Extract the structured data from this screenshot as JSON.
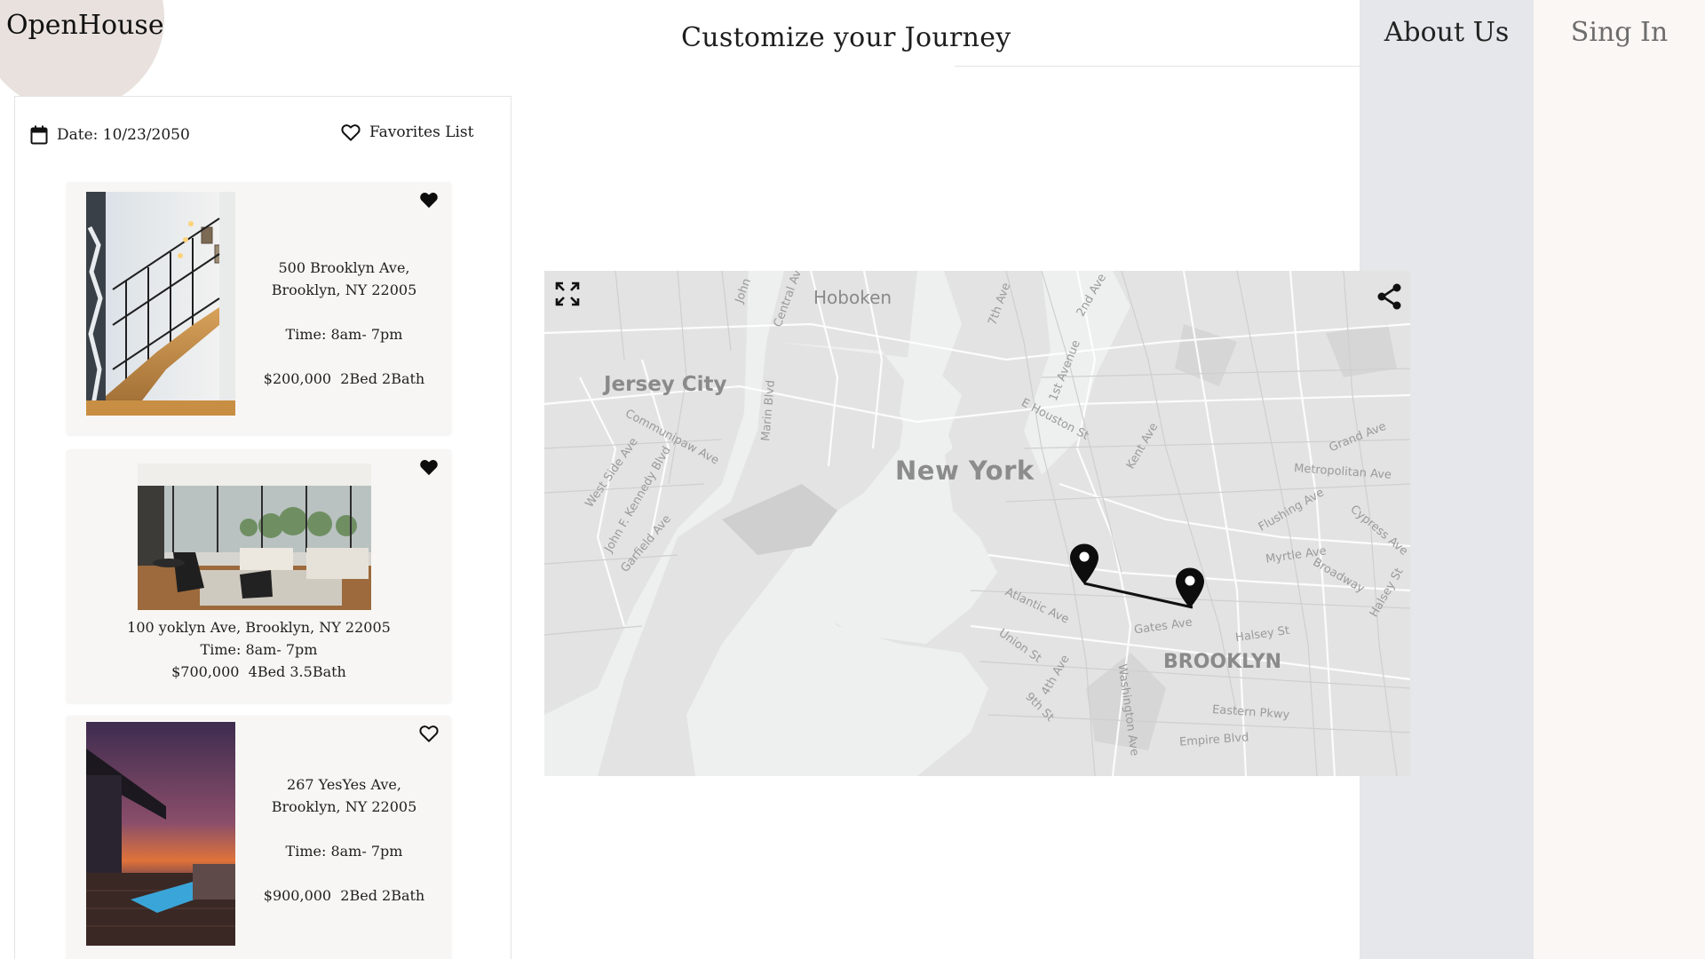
{
  "brand": {
    "name": "OpenHouse"
  },
  "header": {
    "title": "Customize your Journey"
  },
  "nav": {
    "about": "About Us",
    "signin": "Sing In"
  },
  "sidebar": {
    "date_label": "Date: 10/23/2050",
    "favorites_label": "Favorites List",
    "listings": [
      {
        "address_line1": "500 Brooklyn Ave,",
        "address_line2": "Brooklyn, NY 22005",
        "time": "Time: 8am- 7pm",
        "price": "$200,000",
        "details": "2Bed 2Bath",
        "favorited": true
      },
      {
        "address": "100 yoklyn Ave, Brooklyn, NY 22005",
        "time": "Time: 8am- 7pm",
        "price": "$700,000",
        "details": "4Bed 3.5Bath",
        "favorited": true
      },
      {
        "address_line1": "267 YesYes Ave,",
        "address_line2": "Brooklyn, NY 22005",
        "time": "Time: 8am- 7pm",
        "price": "$900,000",
        "details": "2Bed 2Bath",
        "favorited": false
      }
    ]
  },
  "map": {
    "labels": {
      "hoboken": "Hoboken",
      "jersey_city": "Jersey City",
      "new_york": "New York",
      "brooklyn": "BROOKLYN",
      "grand_ave": "Grand Ave",
      "metropolitan_ave": "Metropolitan Ave",
      "flushing_ave": "Flushing Ave",
      "myrtle_ave": "Myrtle Ave",
      "broadway": "Broadway",
      "cypress_ave": "Cypress Ave",
      "halsey_st_e": "Halsey St",
      "atlantic_ave": "Atlantic Ave",
      "gates_ave": "Gates Ave",
      "halsey_st": "Halsey St",
      "union_st": "Union St",
      "fourth_ave": "4th Ave",
      "ninth_st": "9th St",
      "washington_ave": "Washington Ave",
      "eastern_pkwy": "Eastern Pkwy",
      "empire_blvd": "Empire Blvd",
      "communipaw_ave": "Communipaw Ave",
      "west_side_ave": "West Side Ave",
      "jfk_blvd": "John F. Kennedy Blvd",
      "garfield_ave": "Garfield Ave",
      "marin_blvd": "Marin Blvd",
      "seventh_ave": "7th Ave",
      "second_ave": "2nd Ave",
      "first_avenue": "1st Avenue",
      "e_houston": "E Houston St",
      "kent_ave": "Kent Ave",
      "central_ave": "Central Ave",
      "john": "John"
    }
  },
  "colors": {
    "logo_circle": "#e8e1dd",
    "nav_about_bg": "#e6e7ea",
    "nav_signin_bg": "#faf7f4",
    "card_bg": "#f7f6f4",
    "map_bg": "#e5e5e5",
    "water": "#eeefef"
  },
  "icons": {
    "calendar": "calendar-icon",
    "favorites": "heart-outline-icon",
    "favorited": "heart-filled-icon",
    "expand": "expand-icon",
    "share": "share-icon",
    "pin": "map-pin-icon"
  }
}
